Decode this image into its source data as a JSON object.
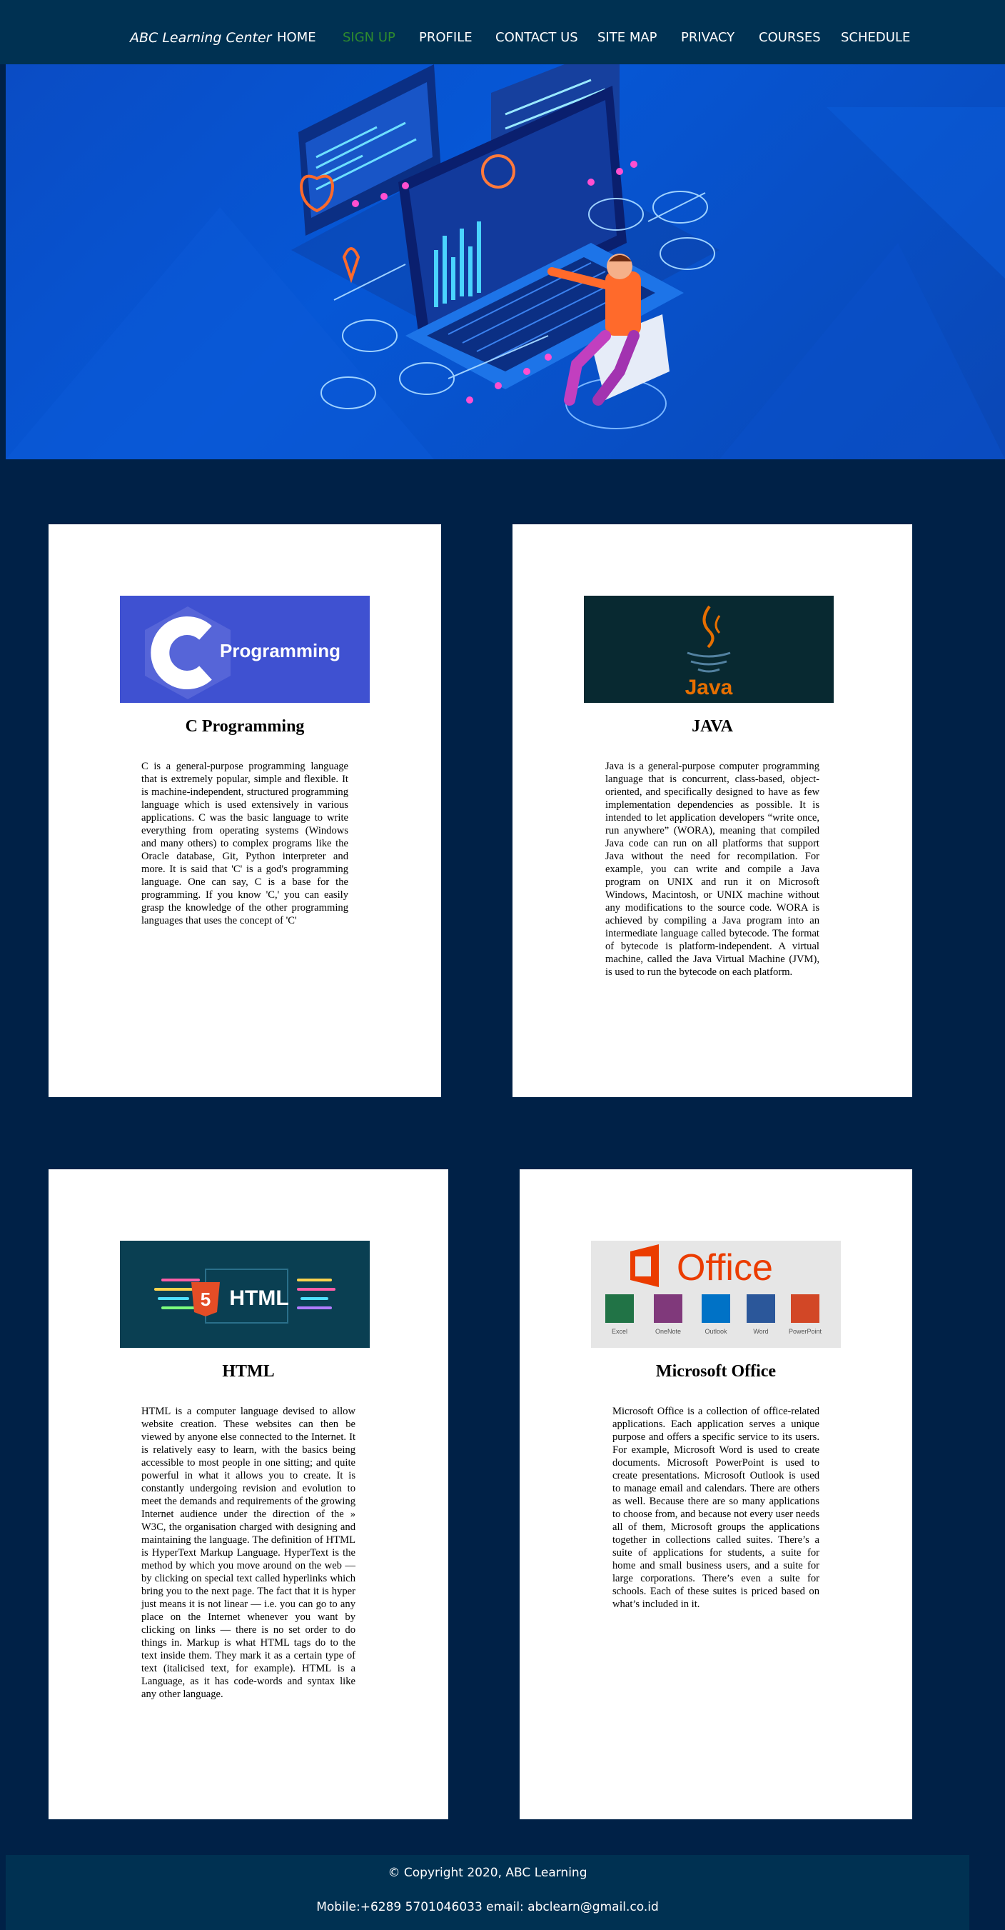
{
  "nav": {
    "brand": "ABC Learning Center",
    "items": [
      "HOME",
      "SIGN UP",
      "PROFILE",
      "CONTACT US",
      "SITE MAP",
      "PRIVACY",
      "COURSES",
      "SCHEDULE"
    ],
    "active": "SIGN UP",
    "active_color": "#2e8b2e"
  },
  "courses": [
    {
      "title": "C Programming",
      "logo_text": "Programming",
      "logo_letter": "C",
      "description": "C is a general-purpose programming language that is extremely popular, simple and flexible. It is machine-independent, structured programming language which is used extensively in various applications. C was the basic language to write everything from operating systems (Windows and many others) to complex programs like the Oracle database, Git, Python interpreter and more. It is said that 'C' is a god's programming language. One can say, C is a base for the programming. If you know 'C,' you can easily grasp the knowledge of the other programming languages that uses the concept of 'C'"
    },
    {
      "title": "JAVA",
      "logo_text": "Java",
      "description": "Java is a general-purpose computer programming language that is concurrent, class-based, object-oriented, and specifically designed to have as few implementation dependencies as possible. It is intended to let application developers “write once, run anywhere” (WORA), meaning that compiled Java code can run on all platforms that support Java without the need for recompilation. For example, you can write and compile a Java program on UNIX and run it on Microsoft Windows, Macintosh, or UNIX machine without any modifications to the source code. WORA is achieved by compiling a Java program into an intermediate language called bytecode. The format of bytecode is platform-independent. A virtual machine, called the Java Virtual Machine (JVM), is used to run the bytecode on each platform."
    },
    {
      "title": "HTML",
      "logo_text": "HTML",
      "logo_badge": "5",
      "description": "HTML is a computer language devised to allow website creation. These websites can then be viewed by anyone else connected to the Internet. It is relatively easy to learn, with the basics being accessible to most people in one sitting; and quite powerful in what it allows you to create. It is constantly undergoing revision and evolution to meet the demands and requirements of the growing Internet audience under the direction of the » W3C, the organisation charged with designing and maintaining the language. The definition of HTML is HyperText Markup Language. HyperText is the method by which you move around on the web — by clicking on special text called hyperlinks which bring you to the next page. The fact that it is hyper just means it is not linear — i.e. you can go to any place on the Internet whenever you want by clicking on links — there is no set order to do things in. Markup is what HTML tags do to the text inside them. They mark it as a certain type of text (italicised text, for example). HTML is a Language, as it has code-words and syntax like any other language."
    },
    {
      "title": "Microsoft Office",
      "logo_text": "Office",
      "apps": [
        "Excel",
        "OneNote",
        "Outlook",
        "Word",
        "PowerPoint"
      ],
      "description": "Microsoft Office is a collection of office-related applications. Each application serves a unique purpose and offers a specific service to its users. For example, Microsoft Word is used to create documents. Microsoft PowerPoint is used to create presentations. Microsoft Outlook is used to manage email and calendars. There are others as well. Because there are so many applications to choose from, and because not every user needs all of them, Microsoft groups the applications together in collections called suites. There’s a suite of applications for students, a suite for home and small business users, and a suite for large corporations. There’s even a suite for schools. Each of these suites is priced based on what’s included in it."
    }
  ],
  "footer": {
    "copyright": "© Copyright 2020, ABC Learning",
    "contact": "Mobile:+6289 5701046033 email: abclearn@gmail.co.id"
  }
}
